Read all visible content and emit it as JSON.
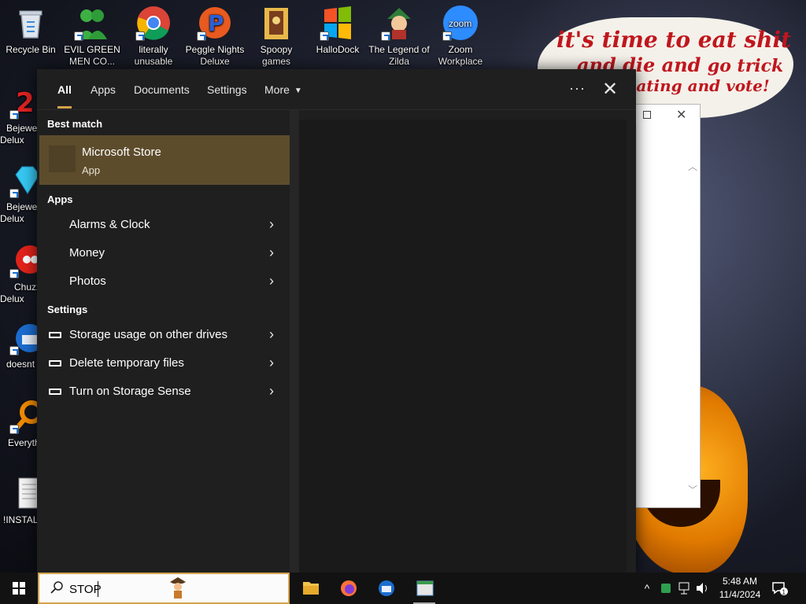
{
  "desktop": {
    "icons": [
      {
        "label": "Recycle Bin",
        "icon": "recycle-bin-icon"
      },
      {
        "label": "EVIL GREEN MEN CO...",
        "icon": "green-men-icon"
      },
      {
        "label": "literally unusable",
        "icon": "chrome-icon"
      },
      {
        "label": "Peggle Nights Deluxe",
        "icon": "peggle-icon"
      },
      {
        "label": "Spoopy games",
        "icon": "folder-icon"
      },
      {
        "label": "HalloDock",
        "icon": "windows-logo-icon"
      },
      {
        "label": "The Legend of Zilda",
        "icon": "zilda-icon"
      },
      {
        "label": "Zoom Workplace",
        "icon": "zoom-icon"
      },
      {
        "label": "Bejewe Delux",
        "icon": "bejeweled-2-icon"
      },
      {
        "label": "Bejewe Delux",
        "icon": "diamond-icon"
      },
      {
        "label": "Chuzz Delux",
        "icon": "chuzzle-icon"
      },
      {
        "label": "doesnt",
        "icon": "thunderbird-icon"
      },
      {
        "label": "Everyth",
        "icon": "everything-search-icon"
      },
      {
        "label": "!INSTALL",
        "icon": "text-file-icon"
      }
    ],
    "wallpaper_text": {
      "line1": "it's time to eat shit",
      "line2_a": "and die and",
      "line2_b": "go trick",
      "line3": "or treating and vote!"
    },
    "zoom_tile_text": "zoom"
  },
  "search_menu": {
    "tabs": [
      {
        "label": "All",
        "active": true
      },
      {
        "label": "Apps",
        "active": false
      },
      {
        "label": "Documents",
        "active": false
      },
      {
        "label": "Settings",
        "active": false
      },
      {
        "label": "More",
        "active": false
      }
    ],
    "more_options": "···",
    "close": "✕",
    "best_match": {
      "heading": "Best match",
      "name": "Microsoft Store",
      "kind": "App"
    },
    "apps": {
      "heading": "Apps",
      "items": [
        "Alarms & Clock",
        "Money",
        "Photos"
      ]
    },
    "settings": {
      "heading": "Settings",
      "items": [
        "Storage usage on other drives",
        "Delete temporary files",
        "Turn on Storage Sense"
      ]
    },
    "chevron": "›"
  },
  "taskbar": {
    "search_query": "STOP",
    "pinned": [
      "file-explorer-icon",
      "firefox-icon",
      "thunderbird-icon",
      "window-app-icon"
    ],
    "tray_expand": "^",
    "time": "5:48 AM",
    "date": "11/4/2024",
    "notification_count": "1"
  },
  "colors": {
    "accent": "#d4a24b",
    "best_match_bg": "#5d4c2c",
    "menu_bg": "#1f1f1f",
    "taskbar_bg": "#121212",
    "wallpaper_text": "#c0161d"
  }
}
